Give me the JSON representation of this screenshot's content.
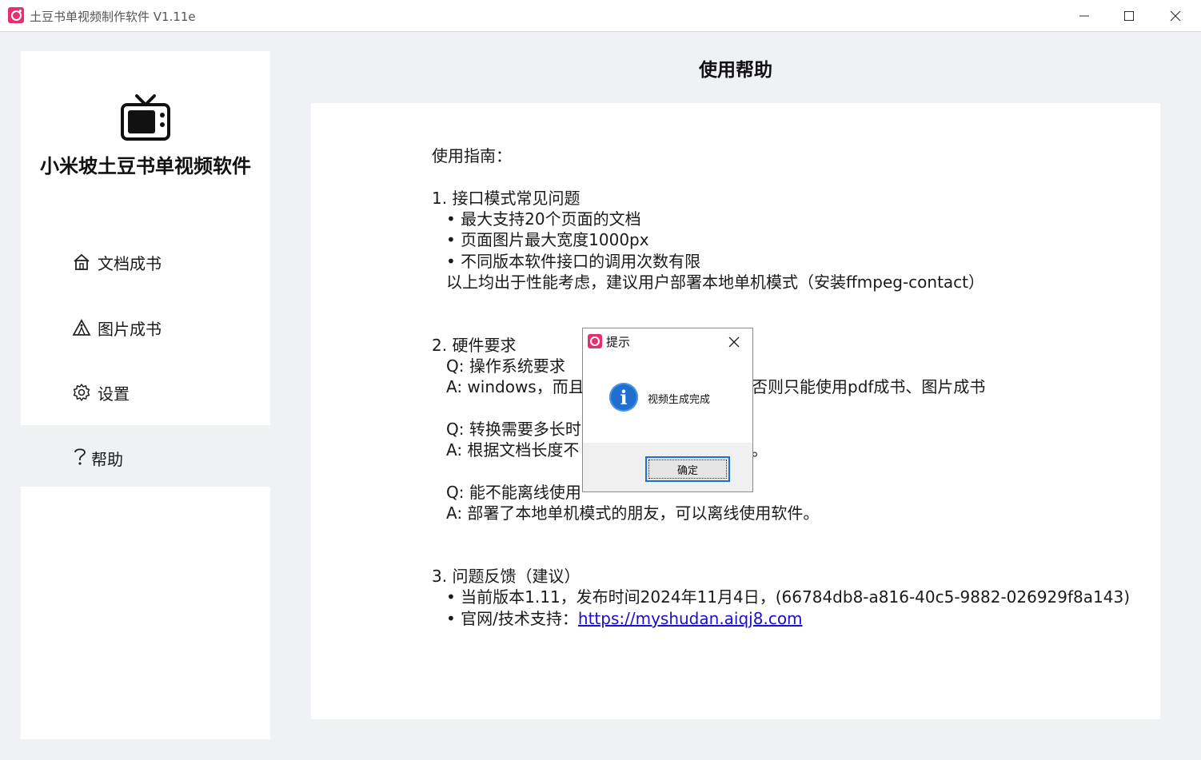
{
  "window": {
    "title": "土豆书单视频制作软件 V1.11e",
    "minimize": "—",
    "maximize": "☐",
    "close": "✕"
  },
  "sidebar": {
    "brand": "小米坡土豆书单视频软件",
    "items": [
      {
        "label": "文档成书",
        "icon": "home-icon"
      },
      {
        "label": "图片成书",
        "icon": "image-book-icon"
      },
      {
        "label": "设置",
        "icon": "gear-icon"
      },
      {
        "label": "帮助",
        "icon": "question-icon",
        "active": true
      }
    ]
  },
  "page": {
    "title": "使用帮助",
    "lines": [
      "使用指南：",
      "1. 接口模式常见问题",
      "• 最大支持20个页面的文档",
      "• 页面图片最大宽度1000px",
      "• 不同版本软件接口的调用次数有限",
      "以上均出于性能考虑，建议用户部署本地单机模式（安装ffmpeg-contact）",
      "2. 硬件要求",
      "Q: 操作系统要求",
      "A: windows，而且",
      "否则只能使用pdf成书、图片成书",
      "Q: 转换需要多长时",
      "A: 根据文档长度不",
      "。",
      "Q: 能不能离线使用",
      "A: 部署了本地单机模式的朋友，可以离线使用软件。",
      "3. 问题反馈（建议）",
      "• 当前版本1.11，发布时间2024年11月4日，(66784db8-a816-40c5-9882-026929f8a143)",
      "• 官网/技术支持："
    ],
    "website_link": "https://myshudan.aiqj8.com"
  },
  "dialog": {
    "title": "提示",
    "message": "视频生成完成",
    "ok_label": "确定",
    "close": "✕"
  },
  "colors": {
    "accent": "#e6306e",
    "link": "#1a0dcc",
    "info": "#1e6fd0"
  }
}
